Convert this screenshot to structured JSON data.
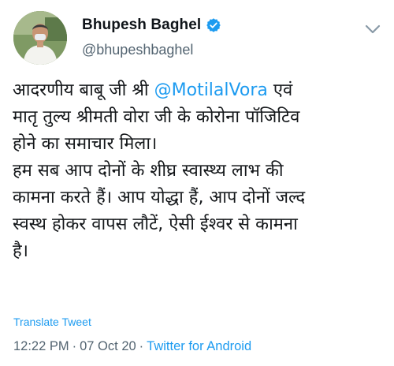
{
  "author": {
    "display_name": "Bhupesh Baghel",
    "handle": "@bhupeshbaghel",
    "verified_icon": "verified-badge-icon",
    "avatar_icon": "profile-photo"
  },
  "menu": {
    "icon": "chevron-down-icon"
  },
  "tweet": {
    "line1_prefix": "आदरणीय बाबू जी श्री ",
    "mention": "@MotilalVora",
    "line1_suffix": " एवं",
    "line2": "मातृ तुल्य श्रीमती वोरा जी के कोरोना पॉजिटिव",
    "line3": "होने का समाचार मिला।",
    "line4": "हम सब आप दोनों के शीघ्र स्वास्थ्य लाभ की",
    "line5": "कामना करते हैं। आप योद्धा हैं, आप दोनों जल्द",
    "line6": "स्वस्थ होकर वापस लौटें, ऐसी ईश्वर से कामना",
    "line7": "है।"
  },
  "translate_label": "Translate Tweet",
  "meta": {
    "time": "12:22 PM",
    "separator": "·",
    "date": "07 Oct 20",
    "source": "Twitter for Android"
  },
  "colors": {
    "link": "#1d9bf0",
    "secondary_text": "#536471",
    "primary_text": "#0f1419"
  }
}
